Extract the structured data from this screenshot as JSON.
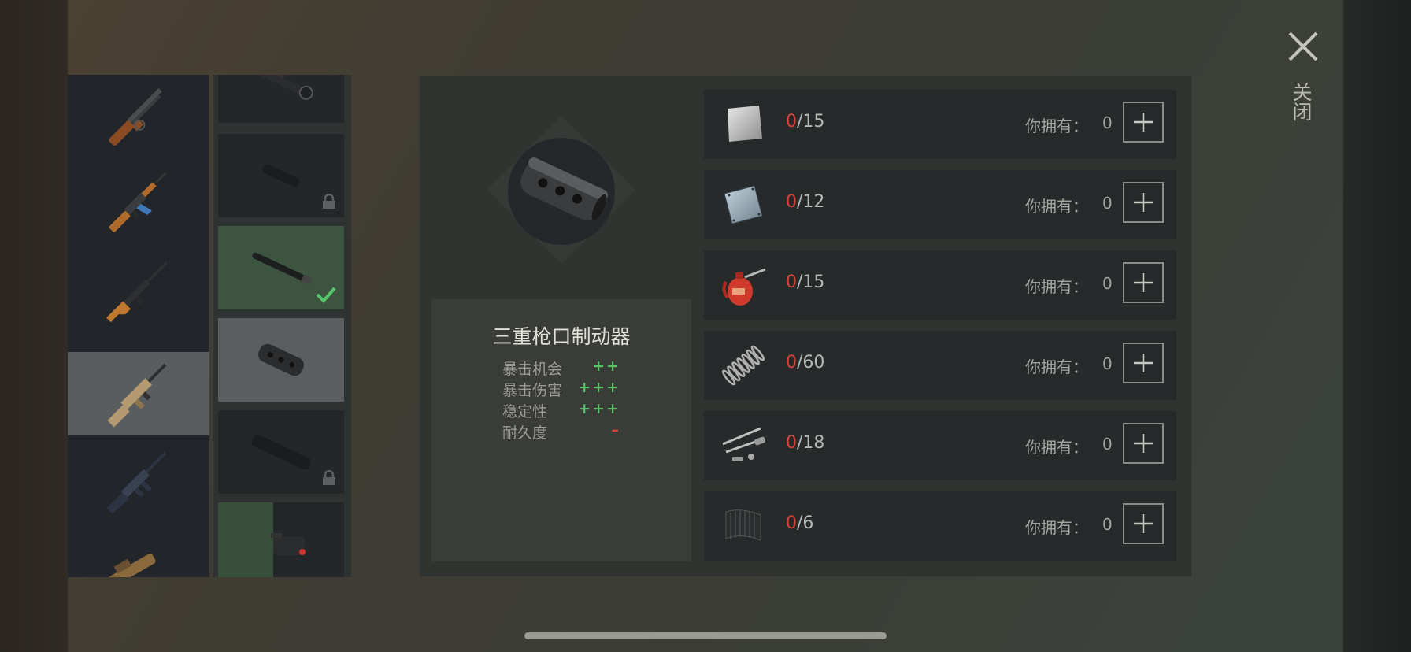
{
  "weapons": [
    {
      "icon": "lever-action-shotgun-icon"
    },
    {
      "icon": "ak-rifle-icon"
    },
    {
      "icon": "svd-rifle-icon"
    },
    {
      "icon": "scar-rifle-icon",
      "selected": true
    },
    {
      "icon": "m16-rifle-icon"
    },
    {
      "icon": "partial-weapon-icon"
    }
  ],
  "attachments": [
    {
      "icon": "scope-icon"
    },
    {
      "icon": "short-suppressor-icon",
      "locked": true
    },
    {
      "icon": "barrel-extension-icon",
      "equipped": true
    },
    {
      "icon": "muzzle-brake-icon",
      "selected": true
    },
    {
      "icon": "long-suppressor-icon",
      "locked": true
    },
    {
      "icon": "laser-sight-icon"
    }
  ],
  "item": {
    "name": "三重枪口制动器",
    "stats": [
      {
        "name": "暴击机会",
        "value": "++",
        "kind": "positive"
      },
      {
        "name": "暴击伤害",
        "value": "+++",
        "kind": "positive"
      },
      {
        "name": "稳定性",
        "value": "+++",
        "kind": "positive"
      },
      {
        "name": "耐久度",
        "value": "–",
        "kind": "negative"
      }
    ]
  },
  "requirements": [
    {
      "icon": "steel-plate-icon",
      "have": "0",
      "need": "/15",
      "owned_label": "你拥有：",
      "owned": "0"
    },
    {
      "icon": "metal-sheet-icon",
      "have": "0",
      "need": "/12",
      "owned_label": "你拥有：",
      "owned": "0"
    },
    {
      "icon": "oil-can-icon",
      "have": "0",
      "need": "/15",
      "owned_label": "你拥有：",
      "owned": "0"
    },
    {
      "icon": "spring-icon",
      "have": "0",
      "need": "/60",
      "owned_label": "你拥有：",
      "owned": "0"
    },
    {
      "icon": "weapon-parts-icon",
      "have": "0",
      "need": "/18",
      "owned_label": "你拥有：",
      "owned": "0"
    },
    {
      "icon": "carbon-fiber-icon",
      "have": "0",
      "need": "/6",
      "owned_label": "你拥有：",
      "owned": "0"
    }
  ],
  "close_label": "关闭",
  "colors": {
    "positive": "#58c46a",
    "negative": "#d9473f"
  }
}
